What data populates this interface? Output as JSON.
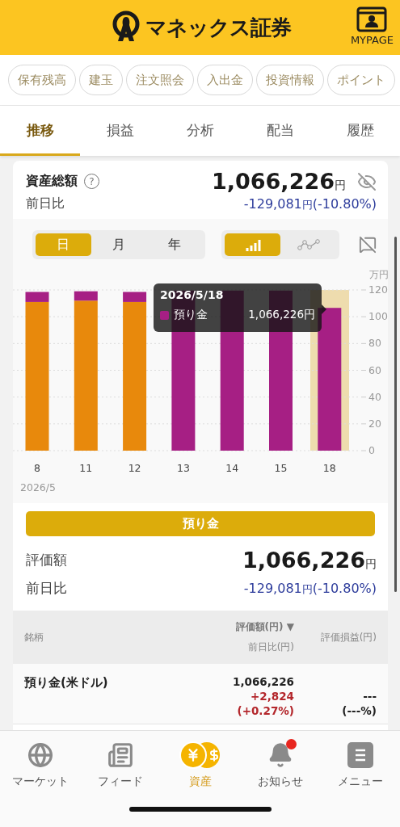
{
  "header": {
    "logo_text": "マネックス証券",
    "mypage_label": "MYPAGE"
  },
  "quick_links": [
    {
      "label": "保有残高"
    },
    {
      "label": "建玉"
    },
    {
      "label": "注文照会"
    },
    {
      "label": "入出金"
    },
    {
      "label": "投資情報"
    },
    {
      "label": "ポイント"
    }
  ],
  "tabs": [
    {
      "label": "推移",
      "selected": true
    },
    {
      "label": "損益",
      "selected": false
    },
    {
      "label": "分析",
      "selected": false
    },
    {
      "label": "配当",
      "selected": false
    },
    {
      "label": "履歴",
      "selected": false
    }
  ],
  "summary": {
    "title": "資産総額",
    "help": "?",
    "total": "1,066,226",
    "unit": "円",
    "change_label": "前日比",
    "change": "-129,081",
    "change_unit": "円",
    "change_pct": "(-10.80%)"
  },
  "period_toggle": [
    {
      "label": "日",
      "selected": true
    },
    {
      "label": "月",
      "selected": false
    },
    {
      "label": "年",
      "selected": false
    }
  ],
  "chart_type_toggle": [
    {
      "kind": "bar",
      "selected": true
    },
    {
      "kind": "line",
      "selected": false
    }
  ],
  "chart_data": {
    "type": "bar",
    "stacked": true,
    "grid": true,
    "ylabel": "万円",
    "xlabel": "2026/5",
    "categories": [
      "8",
      "11",
      "12",
      "13",
      "14",
      "15",
      "18"
    ],
    "ylim": [
      0,
      120
    ],
    "yticks": [
      0,
      20,
      40,
      60,
      80,
      100,
      120
    ],
    "series": [
      {
        "color": "#e8890c",
        "values": [
          111,
          112,
          111,
          0,
          0,
          0,
          0
        ]
      },
      {
        "name": "預り金",
        "color": "#a61f84",
        "values": [
          7.5,
          7,
          7.5,
          119.5,
          119.5,
          119.5,
          106.6
        ]
      }
    ]
  },
  "tooltip": {
    "date": "2026/5/18",
    "value": "1,066,226円"
  },
  "category_button": "預り金",
  "detail": {
    "value_label": "評価額",
    "value": "1,066,226",
    "unit": "円",
    "change_label": "前日比",
    "change": "-129,081",
    "change_unit": "円",
    "change_pct": "(-10.80%)"
  },
  "table": {
    "columns": [
      {
        "label": "銘柄"
      },
      {
        "label": "評価額(円)",
        "sort": "▼",
        "sub_label": "前日比(円)"
      },
      {
        "label": "評価損益(円)"
      }
    ],
    "rows": [
      {
        "name": "預り金(米ドル)",
        "value": "1,066,226",
        "change": "+2,824",
        "change_pct": "(+0.27%)",
        "pl": "---",
        "pl_pct": "(---%)"
      }
    ]
  },
  "bottom_nav": [
    {
      "kind": "globe",
      "label": "マーケット",
      "selected": false,
      "badge": false
    },
    {
      "kind": "feed",
      "label": "フィード",
      "selected": false,
      "badge": false
    },
    {
      "kind": "assets",
      "label": "資産",
      "selected": true,
      "badge": false
    },
    {
      "kind": "bell",
      "label": "お知らせ",
      "selected": false,
      "badge": true
    },
    {
      "kind": "menu",
      "label": "メニュー",
      "selected": false,
      "badge": false
    }
  ]
}
